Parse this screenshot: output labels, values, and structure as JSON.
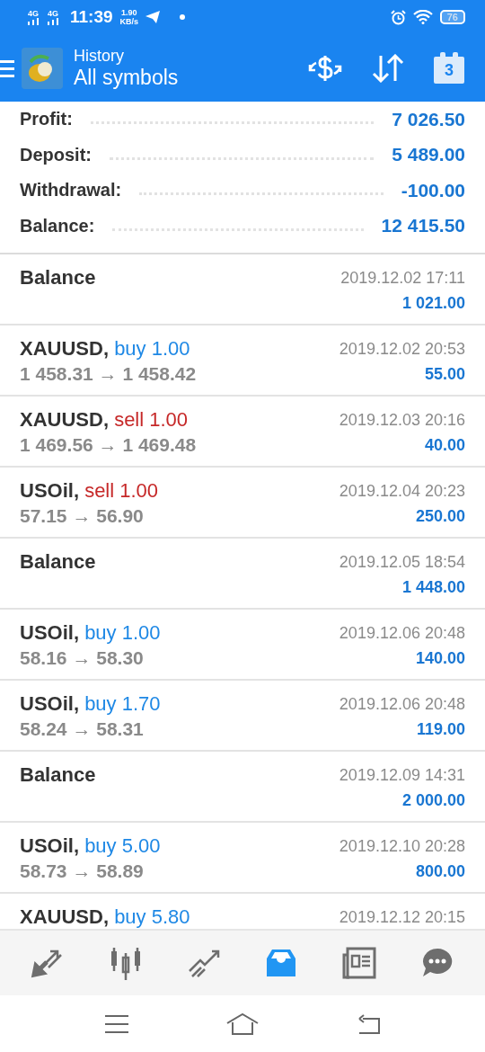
{
  "status_bar": {
    "networks": [
      "4G",
      "4G"
    ],
    "time": "11:39",
    "speed": "1.90",
    "speed_unit": "KB/s",
    "battery": "76"
  },
  "header": {
    "title": "History",
    "subtitle": "All symbols",
    "calendar_day": "3"
  },
  "summary": [
    {
      "label": "Profit:",
      "value": "7 026.50"
    },
    {
      "label": "Deposit:",
      "value": "5 489.00"
    },
    {
      "label": "Withdrawal:",
      "value": "-100.00"
    },
    {
      "label": "Balance:",
      "value": "12 415.50"
    }
  ],
  "deals": [
    {
      "kind": "balance",
      "title": "Balance",
      "time": "2019.12.02 17:11",
      "amount": "1 021.00"
    },
    {
      "kind": "trade",
      "symbol": "XAUUSD,",
      "side": "buy",
      "volume": "1.00",
      "color": "#1e88e5",
      "prices": "1 458.31 → 1 458.42",
      "time": "2019.12.02 20:53",
      "amount": "55.00"
    },
    {
      "kind": "trade",
      "symbol": "XAUUSD,",
      "side": "sell",
      "volume": "1.00",
      "color": "#c62828",
      "prices": "1 469.56 → 1 469.48",
      "time": "2019.12.03 20:16",
      "amount": "40.00"
    },
    {
      "kind": "trade",
      "symbol": "USOil,",
      "side": "sell",
      "volume": "1.00",
      "color": "#c62828",
      "prices": "57.15 → 56.90",
      "time": "2019.12.04 20:23",
      "amount": "250.00"
    },
    {
      "kind": "balance",
      "title": "Balance",
      "time": "2019.12.05 18:54",
      "amount": "1 448.00"
    },
    {
      "kind": "trade",
      "symbol": "USOil,",
      "side": "buy",
      "volume": "1.00",
      "color": "#1e88e5",
      "prices": "58.16 → 58.30",
      "time": "2019.12.06 20:48",
      "amount": "140.00"
    },
    {
      "kind": "trade",
      "symbol": "USOil,",
      "side": "buy",
      "volume": "1.70",
      "color": "#1e88e5",
      "prices": "58.24 → 58.31",
      "time": "2019.12.06 20:48",
      "amount": "119.00"
    },
    {
      "kind": "balance",
      "title": "Balance",
      "time": "2019.12.09 14:31",
      "amount": "2 000.00"
    },
    {
      "kind": "trade",
      "symbol": "USOil,",
      "side": "buy",
      "volume": "5.00",
      "color": "#1e88e5",
      "prices": "58.73 → 58.89",
      "time": "2019.12.10 20:28",
      "amount": "800.00"
    },
    {
      "kind": "trade",
      "symbol": "XAUUSD,",
      "side": "buy",
      "volume": "5.80",
      "color": "#1e88e5",
      "time": "2019.12.12 20:15"
    }
  ],
  "bottom_nav": [
    {
      "selected": false
    },
    {
      "selected": false
    },
    {
      "selected": false
    },
    {
      "selected": true
    },
    {
      "selected": false
    },
    {
      "selected": false
    }
  ]
}
